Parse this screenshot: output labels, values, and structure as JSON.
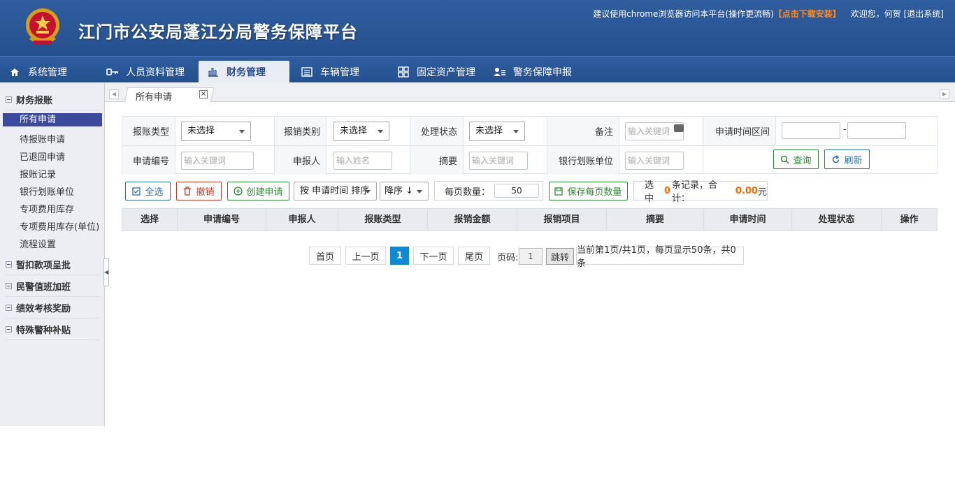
{
  "header": {
    "title": "江门市公安局蓬江分局警务保障平台",
    "browser_tip": "建议使用chrome浏览器访问本平台(操作更流畅)",
    "download_link": "【点击下载安装】",
    "welcome": "欢迎您，何贺",
    "logout": "[退出系统]"
  },
  "nav": {
    "items": [
      {
        "label": "系统管理",
        "icon": "home-icon"
      },
      {
        "label": "人员资料管理",
        "icon": "key-icon"
      },
      {
        "label": "财务管理",
        "icon": "bar-chart-icon"
      },
      {
        "label": "车辆管理",
        "icon": "list-icon"
      },
      {
        "label": "固定资产管理",
        "icon": "grid-icon"
      },
      {
        "label": "警务保障申报",
        "icon": "user-list-icon"
      }
    ],
    "active": "财务管理"
  },
  "sidebar": {
    "groups": [
      {
        "label": "财务报账"
      },
      {
        "label": "暂扣款项呈批"
      },
      {
        "label": "民警值班加班"
      },
      {
        "label": "绩效考核奖励"
      },
      {
        "label": "特殊警种补贴"
      }
    ],
    "items": [
      "所有申请",
      "待报账申请",
      "已退回申请",
      "报账记录",
      "银行划账单位",
      "专项费用库存",
      "专项费用库存(单位)",
      "流程设置"
    ],
    "active": "所有申请"
  },
  "tabs": {
    "open": [
      "所有申请"
    ],
    "close_glyph": "×"
  },
  "filters": {
    "reim_type_label": "报账类型",
    "reim_type_value": "未选择",
    "reim_category_label": "报销类别",
    "reim_category_value": "未选择",
    "status_label": "处理状态",
    "status_value": "未选择",
    "remark_label": "备注",
    "remark_placeholder": "输入关键词",
    "date_range_label": "申请时间区间",
    "date_sep": "-",
    "apply_no_label": "申请编号",
    "apply_no_placeholder": "输入关键词",
    "applicant_label": "申报人",
    "applicant_placeholder": "输入姓名",
    "summary_label": "摘要",
    "summary_placeholder": "输入关键词",
    "bank_unit_label": "银行划账单位",
    "bank_unit_placeholder": "输入关键词",
    "search_button": "查询",
    "refresh_button": "刷新"
  },
  "toolbar": {
    "select_all": "全选",
    "revoke": "撤销",
    "create": "创建申请",
    "sort_by": "按 申请时间 排序",
    "sort_order": "降序 ↓",
    "page_size_label": "每页数量：",
    "page_size_value": "50",
    "save_page_size": "保存每页数量",
    "selected_prefix": "选中",
    "selected_count": "0",
    "selected_mid": "条记录，合计：",
    "selected_total": "0.00",
    "selected_suffix": "元"
  },
  "table": {
    "columns": [
      "选择",
      "申请编号",
      "申报人",
      "报账类型",
      "报销金额",
      "报销项目",
      "摘要",
      "申请时间",
      "处理状态",
      "操作"
    ],
    "rows": []
  },
  "pager": {
    "first": "首页",
    "prev": "上一页",
    "current": "1",
    "next": "下一页",
    "last": "尾页",
    "page_label": "页码:",
    "page_input": "1",
    "jump": "跳转",
    "info": "当前第1页/共1页，每页显示50条，共0条"
  },
  "colors": {
    "header_bg": "#2a5696",
    "active_menu": "#3b4a9d",
    "download_link": "#ff8a1a",
    "pager_current": "#0d8ad6",
    "success_green": "#2e8b3a",
    "danger_red": "#c0392b",
    "info_blue": "#2d6ea8"
  }
}
